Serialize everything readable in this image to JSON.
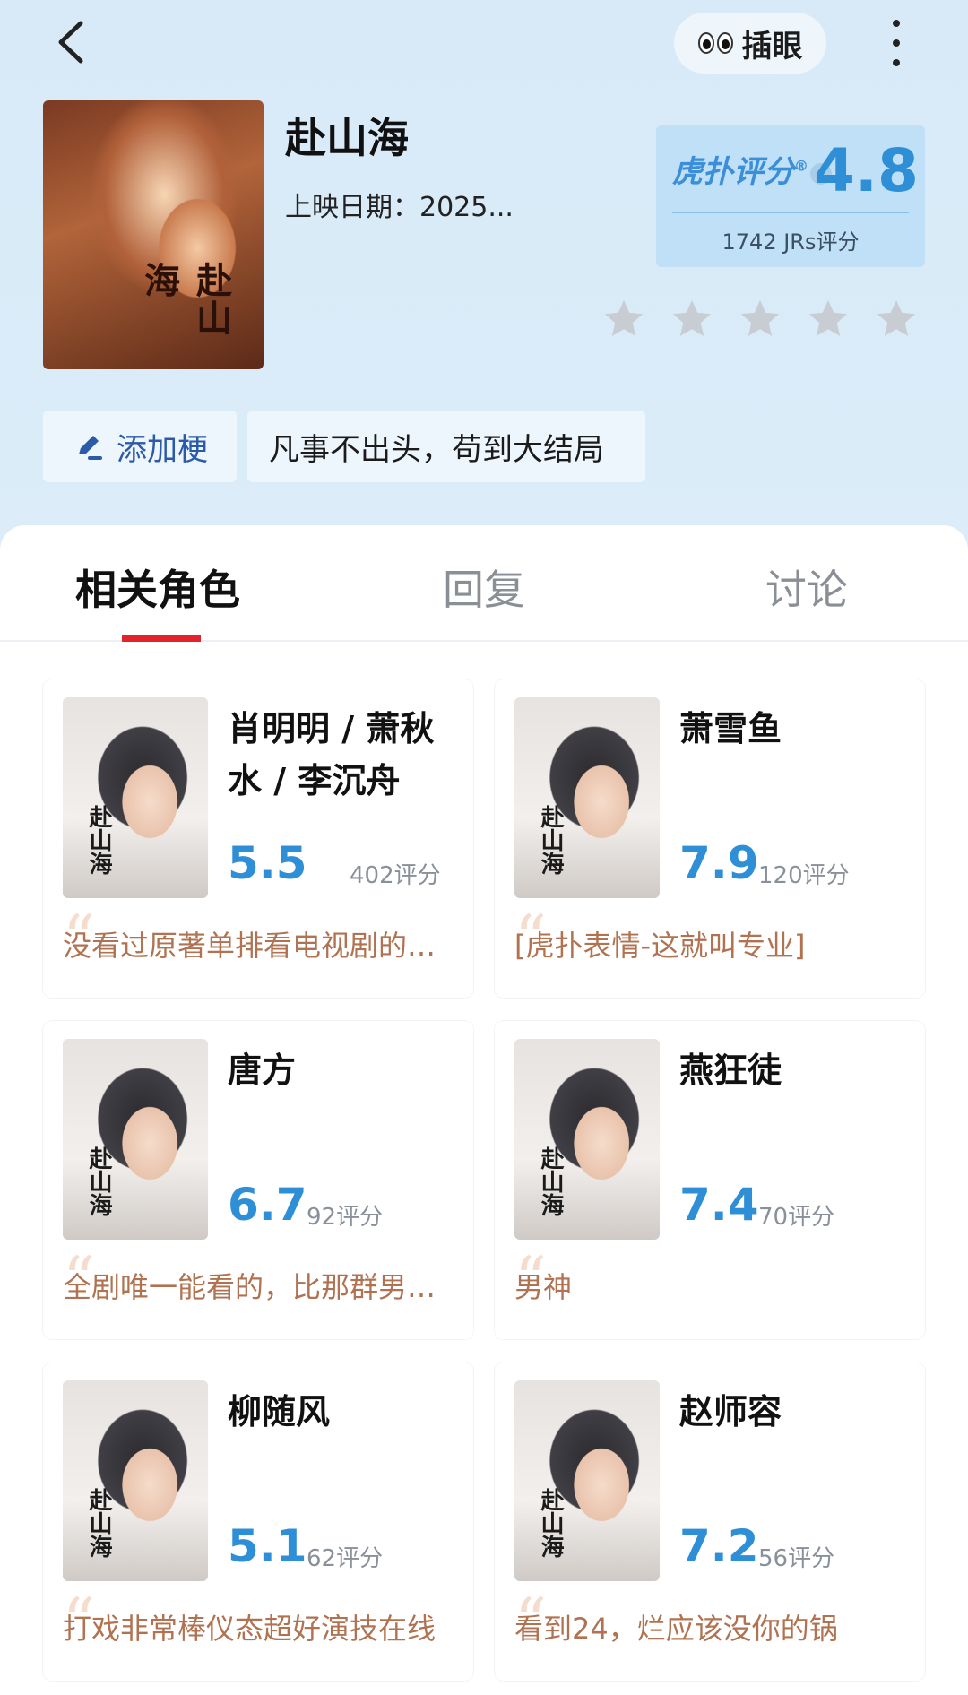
{
  "header": {
    "plugeye_label": "插眼",
    "show_title": "赴山海",
    "release_label": "上映日期：2025...",
    "poster_text": "赴山海"
  },
  "score": {
    "brand": "虎扑评分",
    "value": "4.8",
    "count_label": "1742 JRs评分",
    "stars_total": 5,
    "accent_color": "#2f8fd6"
  },
  "memes": {
    "add_label": "添加梗",
    "tag": "凡事不出头，苟到大结局"
  },
  "tabs": [
    {
      "label": "相关角色",
      "active": true
    },
    {
      "label": "回复",
      "active": false
    },
    {
      "label": "讨论",
      "active": false
    }
  ],
  "characters": [
    {
      "name": "肖明明 / 萧秋水 / 李沉舟",
      "score": "5.5",
      "count": "402评分",
      "comment": "没看过原著单排看电视剧的，这角色真是…"
    },
    {
      "name": "萧雪鱼",
      "score": "7.9",
      "count": "120评分",
      "comment": "[虎扑表情-这就叫专业]"
    },
    {
      "name": "唐方",
      "score": "6.7",
      "count": "92评分",
      "comment": "全剧唯一能看的，比那群男的强多了"
    },
    {
      "name": "燕狂徒",
      "score": "7.4",
      "count": "70评分",
      "comment": "男神"
    },
    {
      "name": "柳随风",
      "score": "5.1",
      "count": "62评分",
      "comment": "打戏非常棒仪态超好演技在线"
    },
    {
      "name": "赵师容",
      "score": "7.2",
      "count": "56评分",
      "comment": "看到24，烂应该没你的锅"
    }
  ],
  "character_poster_text": "赴山海"
}
